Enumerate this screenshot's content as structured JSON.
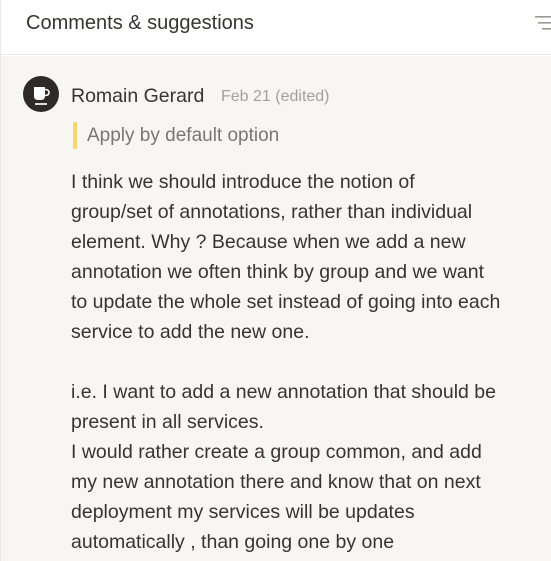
{
  "header": {
    "title": "Comments & suggestions",
    "filter_icon": "filter-icon"
  },
  "comment": {
    "avatar_icon": "coffee-cup-icon",
    "author": "Romain Gerard",
    "date": "Feb 21 (edited)",
    "quoted_text": "Apply by default option",
    "accent_color": "#f5d76e",
    "lines": [
      "I think we should introduce the notion of",
      "group/set of annotations, rather than individual",
      "element. Why ? Because  when we add a new",
      "annotation we often think by group and we want",
      "to update the whole set instead of going into each",
      "service to add the new one.",
      "",
      "i.e. I want to add a new annotation that should be",
      "present in all services.",
      "I would rather create a group common, and add",
      "my new annotation there and know that on next",
      "deployment my services will be updates",
      "automatically , than going one by one"
    ]
  }
}
